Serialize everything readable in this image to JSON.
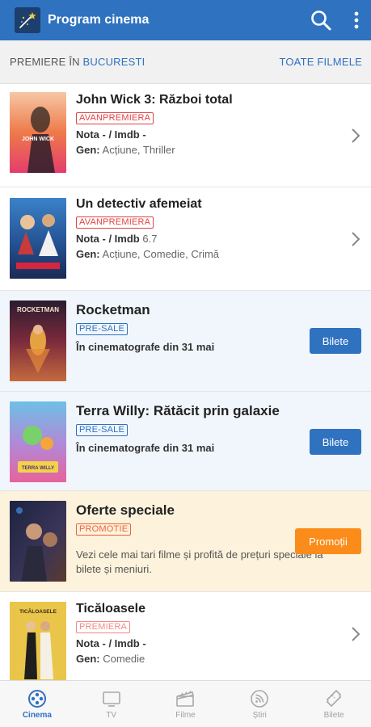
{
  "appbar": {
    "title": "Program cinema"
  },
  "subheader": {
    "premiere_label": "PREMIERE ÎN",
    "city": "BUCURESTI",
    "all_movies": "TOATE FILMELE"
  },
  "movies": [
    {
      "title": "John Wick 3: Război total",
      "badge": "AVANPREMIERA",
      "nota_label": "Nota",
      "nota": "- / Imdb -",
      "gen_label": "Gen:",
      "gen": "Acțiune, Thriller"
    },
    {
      "title": "Un detectiv afemeiat",
      "badge": "AVANPREMIERA",
      "nota_label": "Nota",
      "nota": "- / Imdb",
      "imdb_value": "6.7",
      "gen_label": "Gen:",
      "gen": "Acțiune, Comedie, Crimă"
    },
    {
      "title": "Rocketman",
      "badge": "PRE-SALE",
      "release": "În cinematografe din 31 mai",
      "button": "Bilete"
    },
    {
      "title": "Terra Willy: Rătăcit prin galaxie",
      "badge": "PRE-SALE",
      "release": "În cinematografe din 31 mai",
      "button": "Bilete"
    },
    {
      "title": "Oferte speciale",
      "badge": "PROMOTIE",
      "description": "Vezi cele mai tari filme și profită de prețuri speciale la bilete și meniuri.",
      "button": "Promoții"
    },
    {
      "title": "Ticăloasele",
      "badge": "PREMIERA",
      "nota_label": "Nota",
      "nota": "- / Imdb -",
      "gen_label": "Gen:",
      "gen": "Comedie"
    }
  ],
  "posters": {
    "john_wick": "JOHN WICK",
    "rocketman": "ROCKETMAN",
    "terra_willy": "TERRA WILLY",
    "ticaloasele": "TICĂLOASELE"
  },
  "bottom_nav": [
    {
      "label": "Cinema",
      "icon": "film-reel-icon",
      "active": true
    },
    {
      "label": "TV",
      "icon": "tv-icon",
      "active": false
    },
    {
      "label": "Filme",
      "icon": "clapperboard-icon",
      "active": false
    },
    {
      "label": "Știri",
      "icon": "rss-icon",
      "active": false
    },
    {
      "label": "Bilete",
      "icon": "ticket-icon",
      "active": false
    }
  ],
  "colors": {
    "primary": "#2f72c0",
    "avanpremiera": "#e04343",
    "promo_button": "#fb8c1a",
    "promo_bg": "#fdf2dc",
    "presale_bg": "#f1f6fd"
  }
}
